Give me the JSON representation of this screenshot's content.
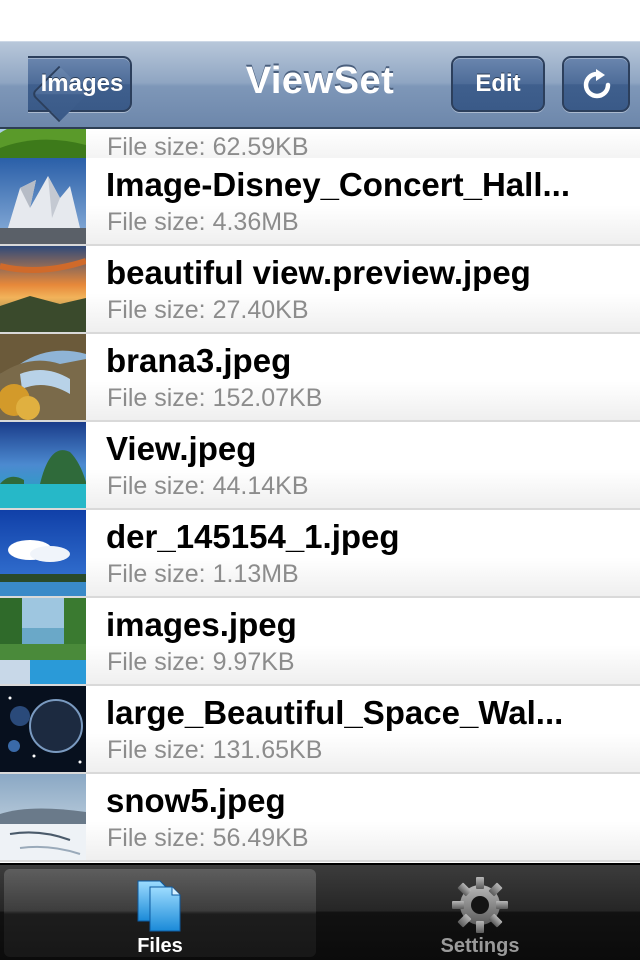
{
  "navbar": {
    "back_label": "Images",
    "title": "ViewSet",
    "edit_label": "Edit",
    "refresh_icon": "refresh-icon"
  },
  "files": [
    {
      "name": "",
      "size": "File size: 62.59KB",
      "thumb": "green-hills"
    },
    {
      "name": "Image-Disney_Concert_Hall...",
      "size": "File size: 4.36MB",
      "thumb": "concert-hall"
    },
    {
      "name": "beautiful view.preview.jpeg",
      "size": "File size: 27.40KB",
      "thumb": "sunset-sky"
    },
    {
      "name": "brana3.jpeg",
      "size": "File size: 152.07KB",
      "thumb": "rock-arch"
    },
    {
      "name": "View.jpeg",
      "size": "File size: 44.14KB",
      "thumb": "tropical-lagoon"
    },
    {
      "name": "der_145154_1.jpeg",
      "size": "File size: 1.13MB",
      "thumb": "blue-sky-clouds"
    },
    {
      "name": "images.jpeg",
      "size": "File size: 9.97KB",
      "thumb": "pool-trees"
    },
    {
      "name": "large_Beautiful_Space_Wal...",
      "size": "File size: 131.65KB",
      "thumb": "space-planet"
    },
    {
      "name": "snow5.jpeg",
      "size": "File size: 56.49KB",
      "thumb": "snow-landscape"
    }
  ],
  "tabbar": {
    "files_label": "Files",
    "settings_label": "Settings",
    "files_icon": "files-icon",
    "settings_icon": "gear-icon",
    "selected": "Files"
  },
  "colors": {
    "navbar": "#8fa5c2",
    "button": "#4d6c98",
    "size_text": "#8c8c8c",
    "tab_active_icon": "#3aa6e8"
  }
}
